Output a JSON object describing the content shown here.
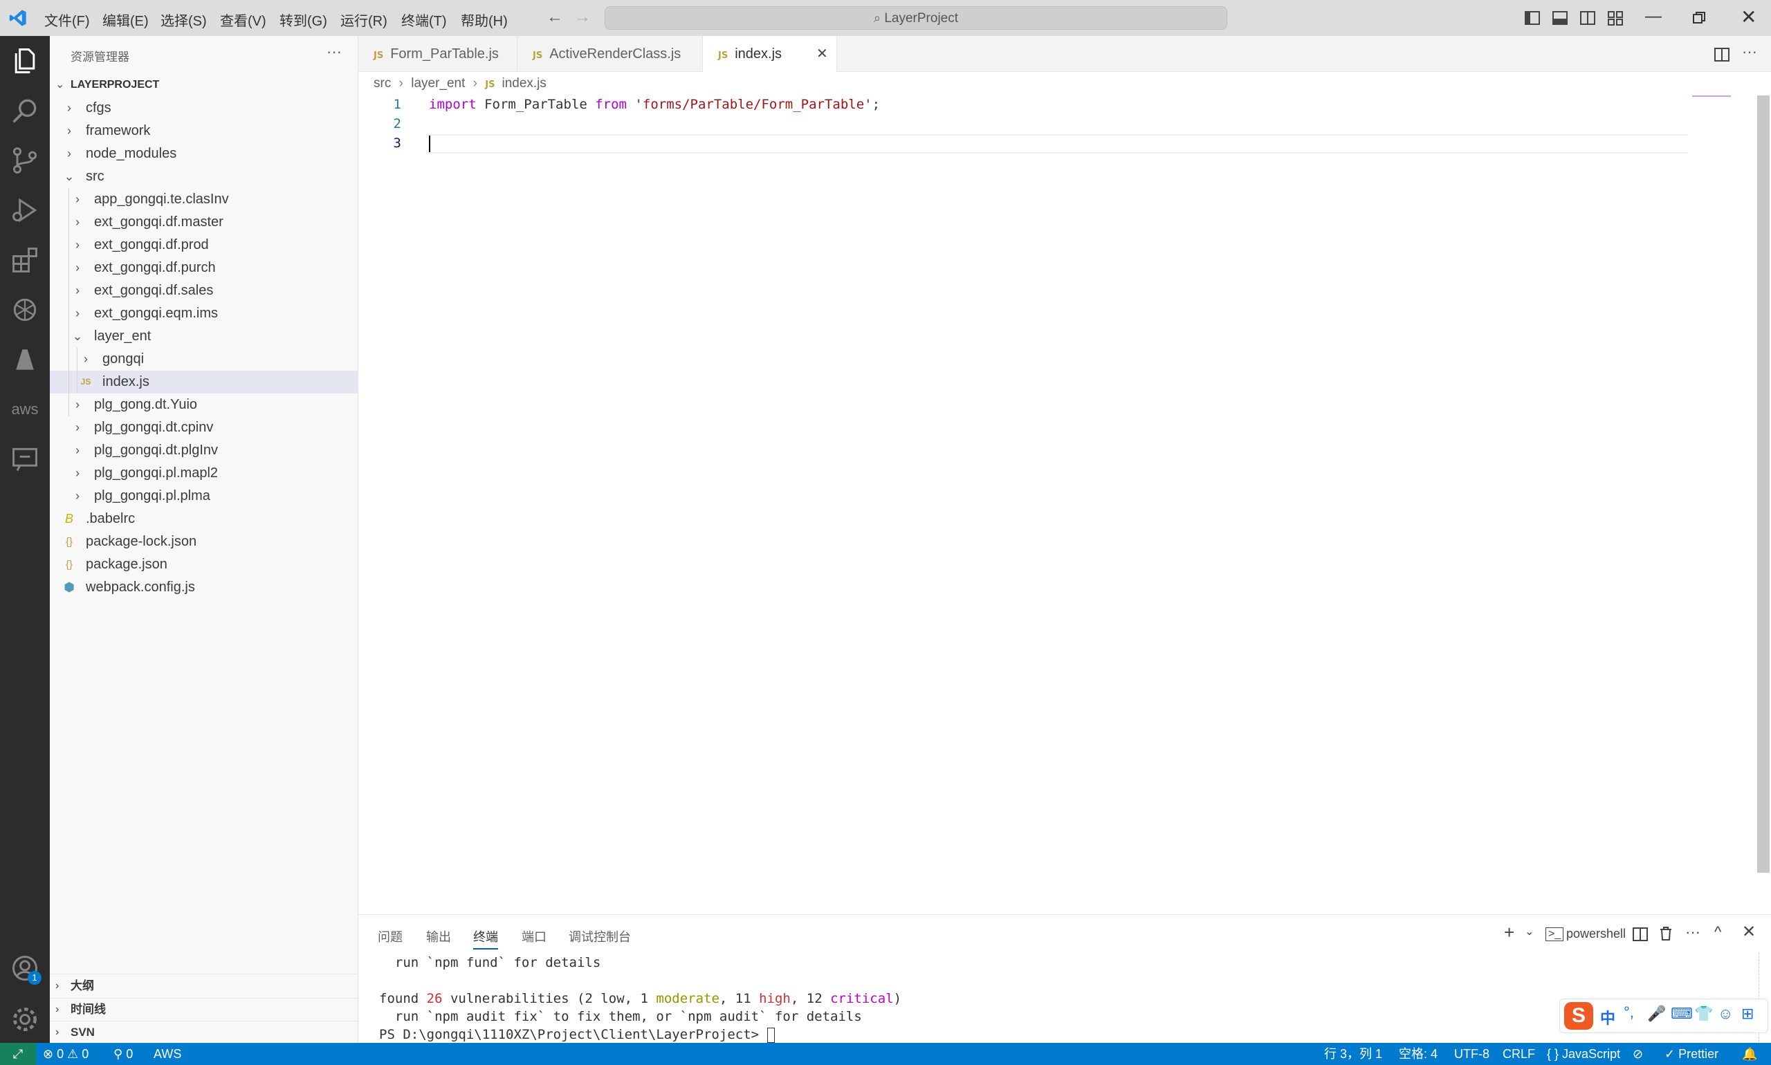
{
  "menu": [
    "文件(F)",
    "编辑(E)",
    "选择(S)",
    "查看(V)",
    "转到(G)",
    "运行(R)",
    "终端(T)",
    "帮助(H)"
  ],
  "search": {
    "placeholder": "LayerProject"
  },
  "sidebar": {
    "title": "资源管理器",
    "more": "···",
    "project": "LAYERPROJECT",
    "tree": [
      {
        "label": "cfgs",
        "depth": 1,
        "type": "folder",
        "open": false
      },
      {
        "label": "framework",
        "depth": 1,
        "type": "folder",
        "open": false
      },
      {
        "label": "node_modules",
        "depth": 1,
        "type": "folder",
        "open": false
      },
      {
        "label": "src",
        "depth": 1,
        "type": "folder",
        "open": true
      },
      {
        "label": "app_gongqi.te.clasInv",
        "depth": 2,
        "type": "folder",
        "open": false
      },
      {
        "label": "ext_gongqi.df.master",
        "depth": 2,
        "type": "folder",
        "open": false
      },
      {
        "label": "ext_gongqi.df.prod",
        "depth": 2,
        "type": "folder",
        "open": false
      },
      {
        "label": "ext_gongqi.df.purch",
        "depth": 2,
        "type": "folder",
        "open": false
      },
      {
        "label": "ext_gongqi.df.sales",
        "depth": 2,
        "type": "folder",
        "open": false
      },
      {
        "label": "ext_gongqi.eqm.ims",
        "depth": 2,
        "type": "folder",
        "open": false
      },
      {
        "label": "layer_ent",
        "depth": 2,
        "type": "folder",
        "open": true
      },
      {
        "label": "gongqi",
        "depth": 3,
        "type": "folder",
        "open": false
      },
      {
        "label": "index.js",
        "depth": 3,
        "type": "js",
        "selected": true
      },
      {
        "label": "plg_gong.dt.Yuio",
        "depth": 2,
        "type": "folder",
        "open": false
      },
      {
        "label": "plg_gongqi.dt.cpinv",
        "depth": 2,
        "type": "folder",
        "open": false
      },
      {
        "label": "plg_gongqi.dt.plgInv",
        "depth": 2,
        "type": "folder",
        "open": false
      },
      {
        "label": "plg_gongqi.pl.mapl2",
        "depth": 2,
        "type": "folder",
        "open": false
      },
      {
        "label": "plg_gongqi.pl.plma",
        "depth": 2,
        "type": "folder",
        "open": false
      },
      {
        "label": ".babelrc",
        "depth": 1,
        "type": "babel"
      },
      {
        "label": "package-lock.json",
        "depth": 1,
        "type": "json"
      },
      {
        "label": "package.json",
        "depth": 1,
        "type": "json"
      },
      {
        "label": "webpack.config.js",
        "depth": 1,
        "type": "webpack"
      }
    ],
    "bottom_sections": [
      "大纲",
      "时间线",
      "SVN"
    ]
  },
  "tabs": [
    {
      "label": "Form_ParTable.js",
      "badge": "JS",
      "active": false
    },
    {
      "label": "ActiveRenderClass.js",
      "badge": "JS",
      "active": false
    },
    {
      "label": "index.js",
      "badge": "JS",
      "active": true
    }
  ],
  "breadcrumb": {
    "parts": [
      "src",
      "layer_ent"
    ],
    "file": "index.js",
    "badge": "JS"
  },
  "editor": {
    "line_numbers": [
      "1",
      "2",
      "3"
    ],
    "line1": {
      "kw1": "import",
      "ident": " Form_ParTable ",
      "kw2": "from",
      "str": " 'forms/ParTable/Form_ParTable'",
      "end": ";"
    }
  },
  "panel": {
    "tabs": [
      "问题",
      "输出",
      "终端",
      "端口",
      "调试控制台"
    ],
    "active_tab": "终端",
    "shell": "powershell",
    "lines": {
      "l1": "  run `npm fund` for details",
      "l2_a": "found ",
      "l2_b": "26",
      "l2_c": " vulnerabilities (2 low, 1 ",
      "l2_d": "moderate",
      "l2_e": ", 11 ",
      "l2_f": "high",
      "l2_g": ", 12 ",
      "l2_h": "critical",
      "l2_i": ")",
      "l3": "  run `npm audit fix` to fix them, or `npm audit` for details",
      "l4": "PS D:\\gongqi\\1110XZ\\Project\\Client\\LayerProject> "
    }
  },
  "status": {
    "errors": "0",
    "warnings": "0",
    "ports": "0",
    "aws": "AWS",
    "position": "行 3，列 1",
    "spaces": "空格: 4",
    "encoding": "UTF-8",
    "eol": "CRLF",
    "language": "JavaScript",
    "formatter": "Prettier"
  },
  "accounts_badge": "1",
  "ime": {
    "lang": "中"
  },
  "colors": {
    "accent": "#007acc",
    "remote": "#16825d",
    "jsbadge": "#b7a33d"
  }
}
